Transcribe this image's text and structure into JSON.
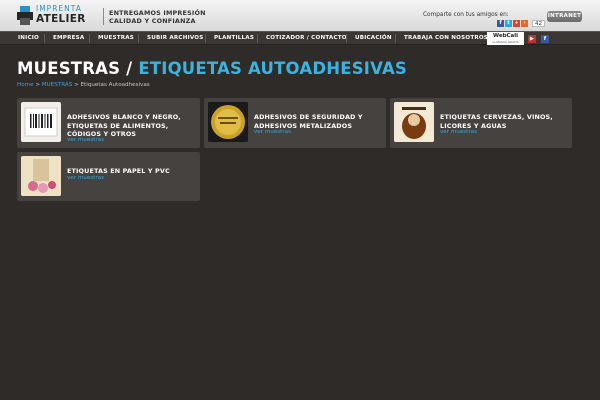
{
  "header": {
    "logo_top": "IMPRENTA",
    "logo_bottom": "ATELIER",
    "tagline_1": "ENTREGAMOS IMPRESIÓN",
    "tagline_2": "CALIDAD Y CONFIANZA",
    "share_text": "Comparte con tus amigos en:",
    "share_count": "42",
    "intranet_label": "INTRANET",
    "social_icons": [
      "facebook-icon",
      "twitter-icon",
      "google-plus-icon",
      "more-icon"
    ]
  },
  "nav": {
    "items": [
      "INICIO",
      "EMPRESA",
      "MUESTRAS",
      "SUBIR ARCHIVOS",
      "PLANTILLAS",
      "COTIZADOR / CONTACTO",
      "UBICACIÓN",
      "TRABAJA CON NOSOTROS"
    ],
    "webcall_label": "WebCall",
    "webcall_sub": "LLAMADA GRATIS",
    "extra_icons": [
      "youtube-icon",
      "facebook-icon"
    ]
  },
  "page": {
    "title_main": "MUESTRAS /",
    "title_sub": "ETIQUETAS AUTOADHESIVAS",
    "breadcrumb": {
      "home": "Home",
      "sep": ">",
      "section": "MUESTRAS",
      "current": "Etiquetas Autoadhesivas"
    }
  },
  "cards": [
    {
      "title": "ADHESIVOS BLANCO Y NEGRO, ETIQUETAS DE ALIMENTOS, CÓDIGOS Y OTROS",
      "link": "ver muestras"
    },
    {
      "title": "ADHESIVOS DE SEGURIDAD Y ADHESIVOS METALIZADOS",
      "link": "ver muestras"
    },
    {
      "title": "ETIQUETAS CERVEZAS, VINOS, LICORES Y AGUAS",
      "link": "ver muestras"
    },
    {
      "title": "ETIQUETAS EN PAPEL Y PVC",
      "link": "ver muestras"
    }
  ],
  "colors": {
    "accent": "#3ab3e0",
    "link": "#3aa6d8",
    "background": "#2e2b29",
    "card": "#45423f",
    "nav": "#3a3735"
  }
}
